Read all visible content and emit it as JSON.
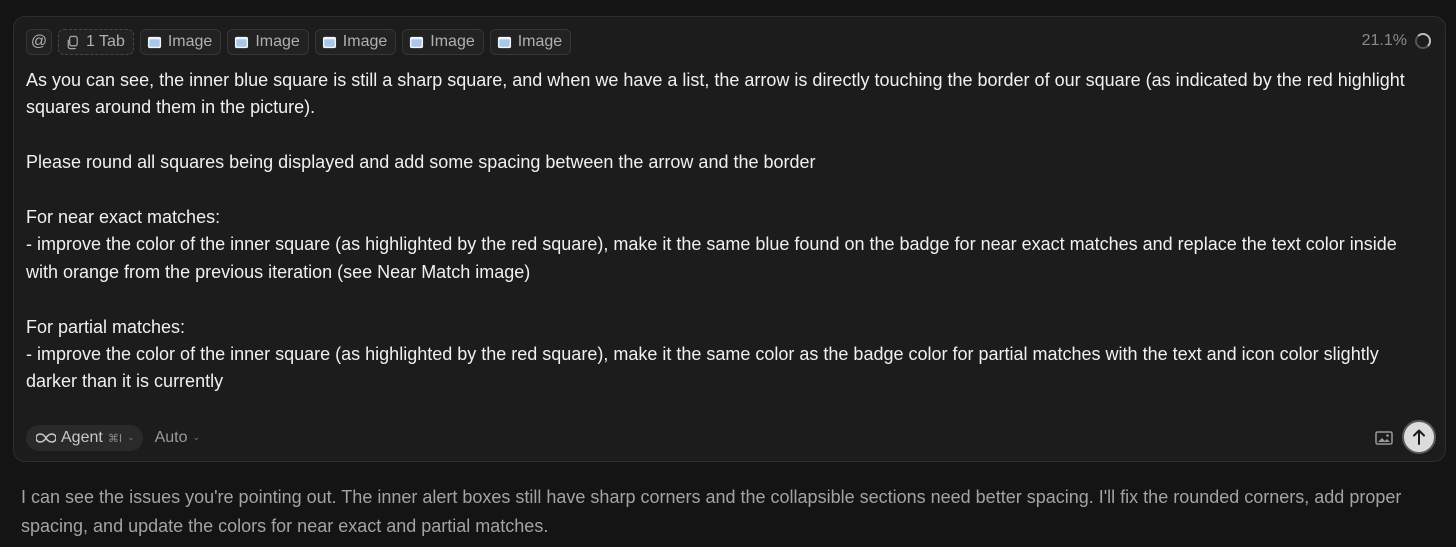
{
  "composer": {
    "at_symbol": "@",
    "context_chips": [
      {
        "label": "1 Tab",
        "icon": "copy-icon"
      },
      {
        "label": "Image",
        "icon": "image-icon"
      },
      {
        "label": "Image",
        "icon": "image-icon"
      },
      {
        "label": "Image",
        "icon": "image-icon"
      },
      {
        "label": "Image",
        "icon": "image-icon"
      },
      {
        "label": "Image",
        "icon": "image-icon"
      }
    ],
    "context_usage": "21.1%",
    "message_paragraphs": [
      [
        "As you can see, the inner blue square is still a sharp square, and when we have a list, the arrow is directly touching the border of our square (as indicated by the red highlight squares around them in the picture)."
      ],
      [
        "Please round all squares being displayed and add some spacing between the arrow and the border"
      ],
      [
        "For near exact matches:",
        "- improve the color of the inner square (as highlighted by the red square), make it the same blue found on the badge for near exact matches and replace the text color inside with orange from the previous iteration (see Near Match image)"
      ],
      [
        "For partial matches:",
        "- improve the color of the inner square (as highlighted by the red square), make it the same color as the badge color for partial matches with the text and icon color slightly darker than it is currently"
      ]
    ],
    "mode": {
      "label": "Agent",
      "shortcut": "⌘I",
      "icon": "infinity-icon"
    },
    "model": {
      "label": "Auto"
    }
  },
  "reply": {
    "text": "I can see the issues you're pointing out. The inner alert boxes still have sharp corners and the collapsible sections need better spacing. I'll fix the rounded corners, add proper spacing, and update the colors for near exact and partial matches."
  },
  "colors": {
    "background": "#141414",
    "composer_bg": "#1c1c1c",
    "image_icon_accent": "#a9c7ea"
  }
}
